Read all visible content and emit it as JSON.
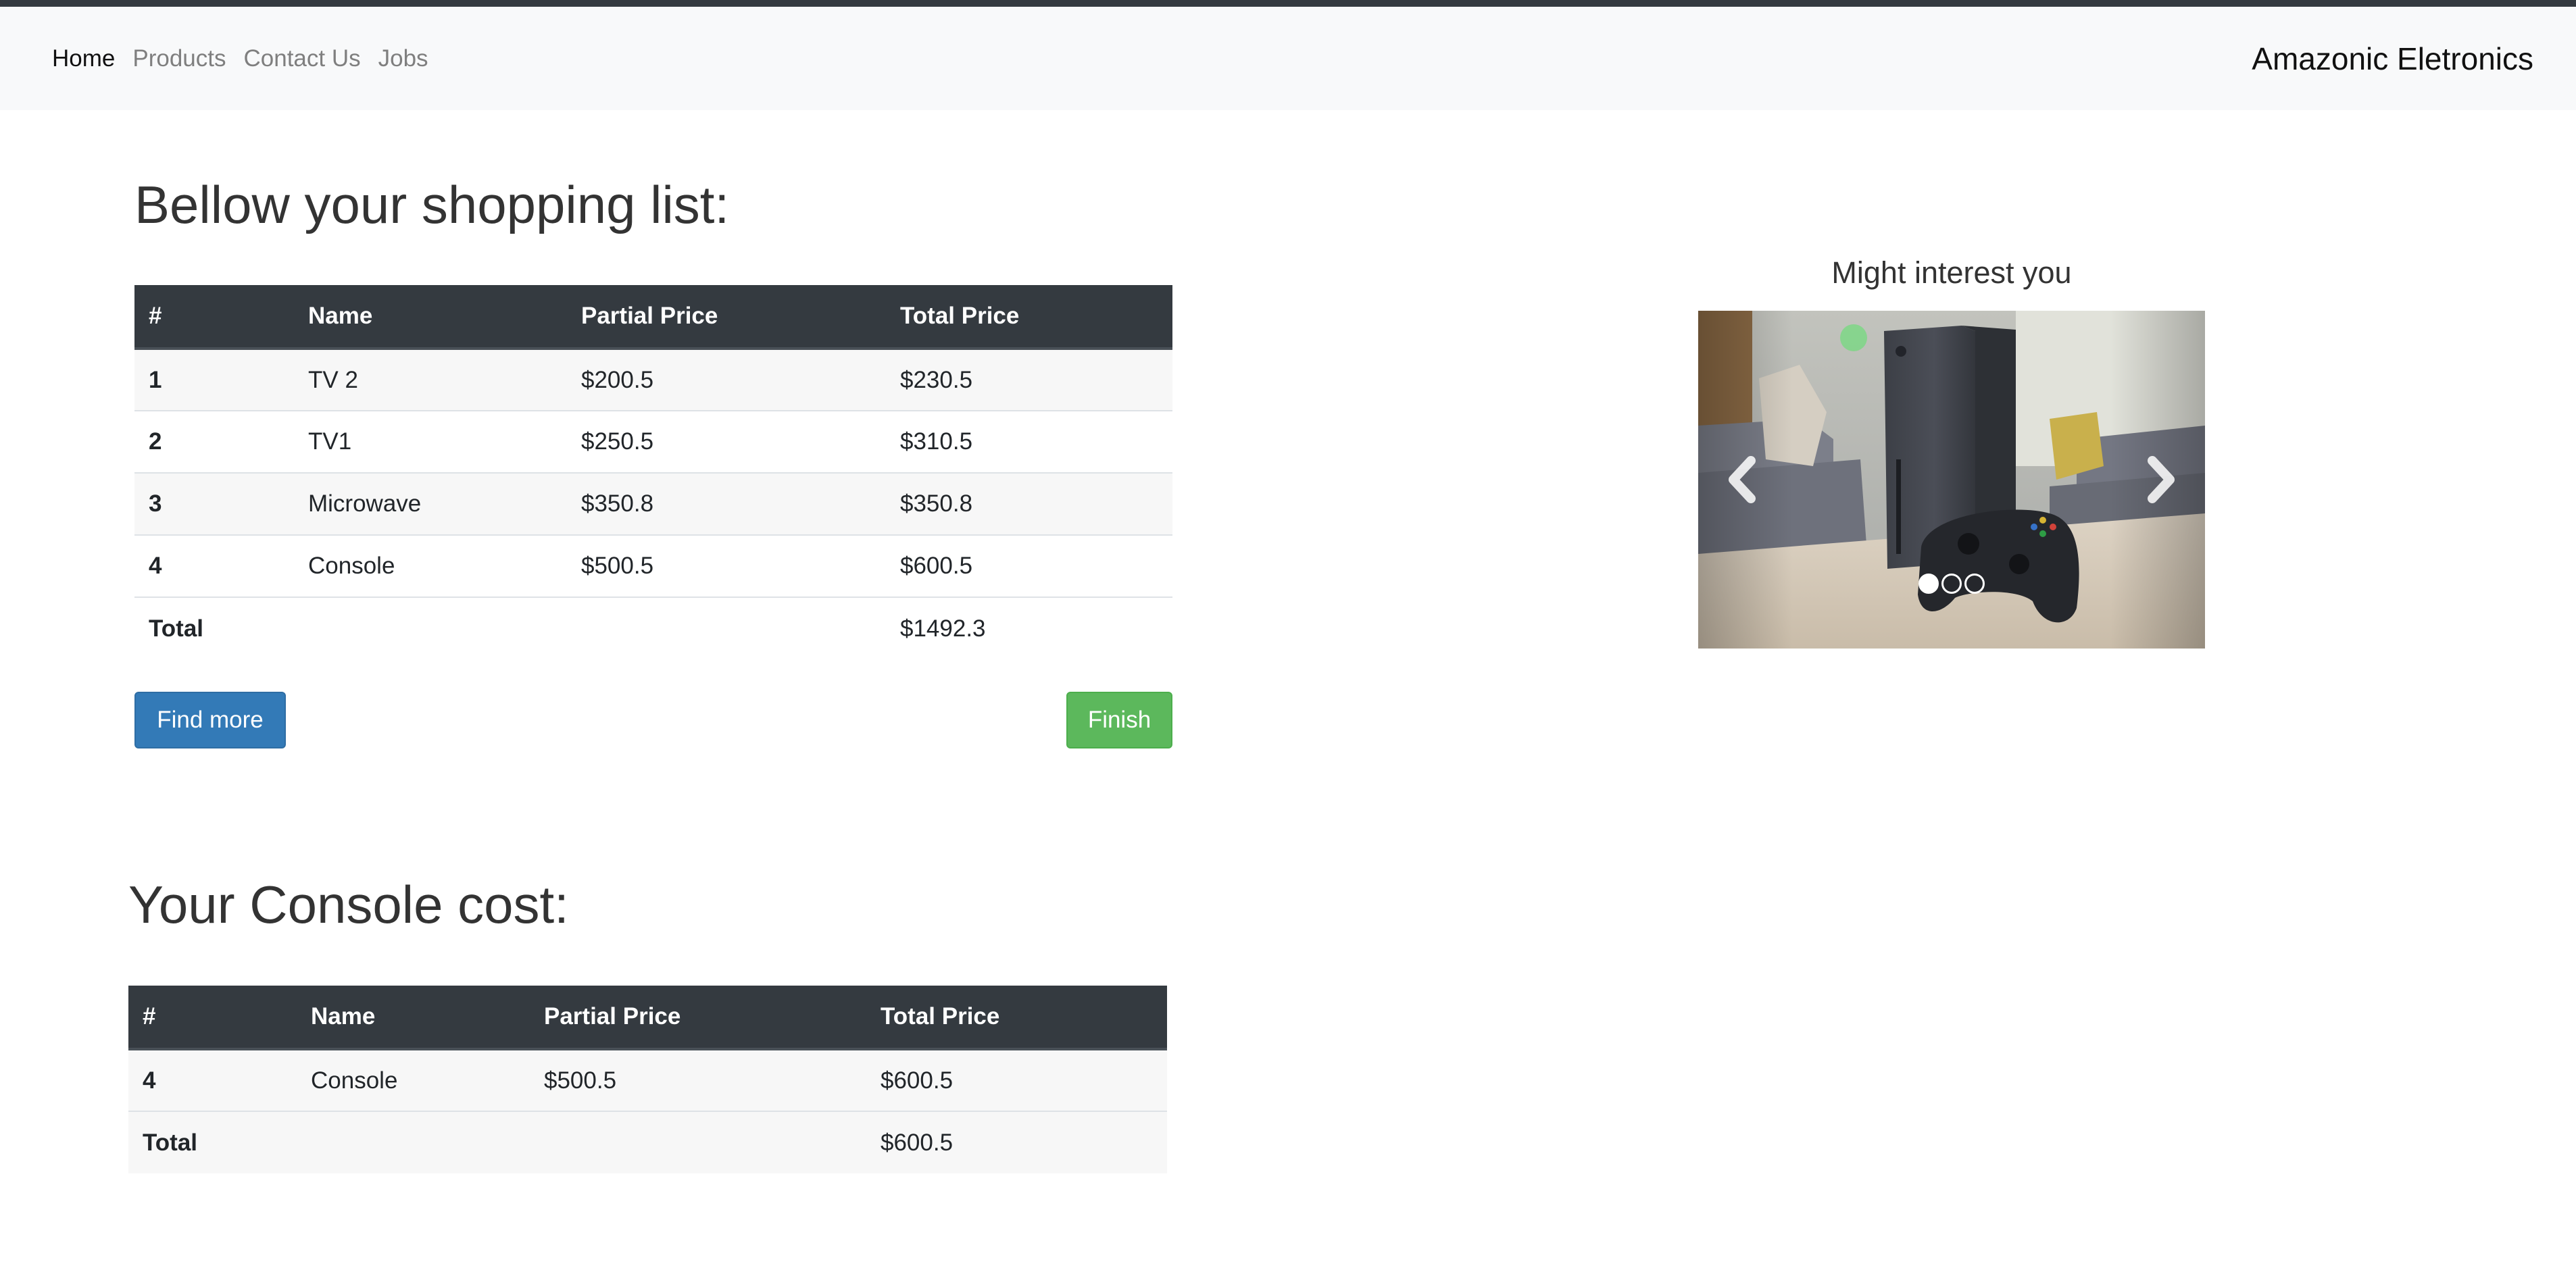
{
  "navbar": {
    "links": [
      {
        "label": "Home"
      },
      {
        "label": "Products"
      },
      {
        "label": "Contact Us"
      },
      {
        "label": "Jobs"
      }
    ],
    "brand": "Amazonic Eletronics"
  },
  "shopping": {
    "heading": "Bellow your shopping list:",
    "columns": [
      "#",
      "Name",
      "Partial Price",
      "Total Price"
    ],
    "rows": [
      {
        "num": "1",
        "name": "TV 2",
        "partial": "$200.5",
        "total": "$230.5"
      },
      {
        "num": "2",
        "name": "TV1",
        "partial": "$250.5",
        "total": "$310.5"
      },
      {
        "num": "3",
        "name": "Microwave",
        "partial": "$350.8",
        "total": "$350.8"
      },
      {
        "num": "4",
        "name": "Console",
        "partial": "$500.5",
        "total": "$600.5"
      }
    ],
    "total_label": "Total",
    "total_value": "$1492.3",
    "find_more_label": "Find more",
    "finish_label": "Finish"
  },
  "carousel": {
    "title": "Might interest you",
    "slide_count": 3,
    "active_slide": 1,
    "slide_subject": "game console with controller on a table in a living room"
  },
  "console_cost": {
    "heading": "Your Console cost:",
    "columns": [
      "#",
      "Name",
      "Partial Price",
      "Total Price"
    ],
    "rows": [
      {
        "num": "4",
        "name": "Console",
        "partial": "$500.5",
        "total": "$600.5"
      }
    ],
    "total_label": "Total",
    "total_value": "$600.5"
  },
  "colors": {
    "navbar_bg": "#f8f9fa",
    "table_header_bg": "#343a40",
    "primary_button": "#337ab7",
    "success_button": "#5cb85c"
  }
}
